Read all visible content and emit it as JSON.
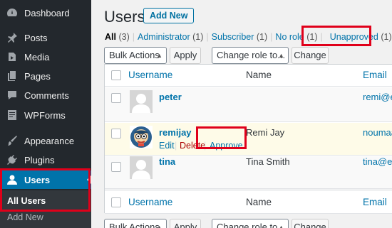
{
  "sidebar": {
    "items": [
      {
        "label": "Dashboard",
        "icon": "dashboard-icon"
      },
      {
        "label": "Posts",
        "icon": "pin-icon"
      },
      {
        "label": "Media",
        "icon": "media-icon"
      },
      {
        "label": "Pages",
        "icon": "pages-icon"
      },
      {
        "label": "Comments",
        "icon": "comment-icon"
      },
      {
        "label": "WPForms",
        "icon": "forms-icon"
      },
      {
        "label": "Appearance",
        "icon": "paintbrush-icon"
      },
      {
        "label": "Plugins",
        "icon": "plugin-icon"
      },
      {
        "label": "Users",
        "icon": "user-icon",
        "active": true
      }
    ],
    "submenu": [
      "All Users",
      "Add New"
    ]
  },
  "header": {
    "title": "Users",
    "add_new": "Add New"
  },
  "views": [
    {
      "label": "All",
      "count": "(3)"
    },
    {
      "label": "Administrator",
      "count": "(1)"
    },
    {
      "label": "Subscriber",
      "count": "(1)"
    },
    {
      "label": "No role",
      "count": "(1)"
    },
    {
      "label": "Unapproved",
      "count": "(1)"
    }
  ],
  "toolbar": {
    "bulk_actions": "Bulk Actions",
    "apply": "Apply",
    "change_role": "Change role to...",
    "change": "Change"
  },
  "table": {
    "columns": [
      "Username",
      "Name",
      "Email"
    ],
    "rows": [
      {
        "username": "peter",
        "name": "",
        "email": "remi@ex"
      },
      {
        "username": "remijay",
        "name": "Remi Jay",
        "email": "noumaa",
        "actions": [
          "Edit",
          "Delete",
          "Approve"
        ]
      },
      {
        "username": "tina",
        "name": "Tina Smith",
        "email": "tina@ex"
      }
    ]
  },
  "colors": {
    "sidebar_bg": "#23282d",
    "active": "#0073aa",
    "link": "#0073aa",
    "highlight": "#e0001a",
    "delete": "#a00"
  }
}
